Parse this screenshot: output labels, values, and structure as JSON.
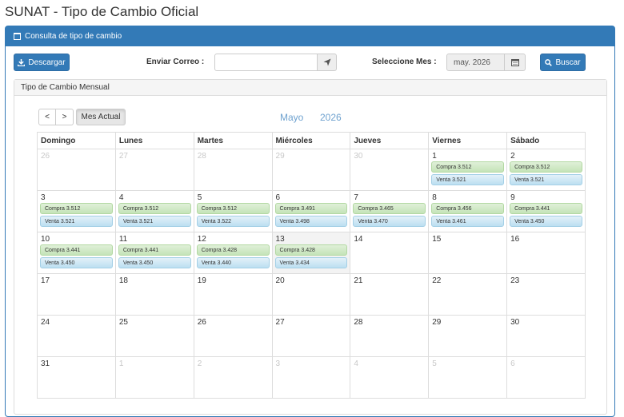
{
  "page": {
    "title": "SUNAT - Tipo de Cambio Oficial"
  },
  "panel": {
    "title": "Consulta de tipo de cambio"
  },
  "toolbar": {
    "download_label": "Descargar",
    "email_label": "Enviar Correo :",
    "email_value": "",
    "month_label": "Seleccione Mes :",
    "month_value": "may. 2026",
    "search_label": "Buscar"
  },
  "calendar": {
    "panel_title": "Tipo de Cambio Mensual",
    "prev_label": "<",
    "next_label": ">",
    "current_month_label": "Mes Actual",
    "month": "Mayo",
    "year": "2026",
    "weekdays": [
      "Domingo",
      "Lunes",
      "Martes",
      "Miércoles",
      "Jueves",
      "Viernes",
      "Sábado"
    ],
    "weeks": [
      [
        {
          "day": "26",
          "other": true
        },
        {
          "day": "27",
          "other": true
        },
        {
          "day": "28",
          "other": true
        },
        {
          "day": "29",
          "other": true
        },
        {
          "day": "30",
          "other": true
        },
        {
          "day": "1",
          "buy": "Compra 3.512",
          "sell": "Venta 3.521"
        },
        {
          "day": "2",
          "buy": "Compra 3.512",
          "sell": "Venta 3.521"
        }
      ],
      [
        {
          "day": "3",
          "buy": "Compra 3.512",
          "sell": "Venta 3.521"
        },
        {
          "day": "4",
          "buy": "Compra 3.512",
          "sell": "Venta 3.521"
        },
        {
          "day": "5",
          "buy": "Compra 3.512",
          "sell": "Venta 3.522"
        },
        {
          "day": "6",
          "buy": "Compra 3.491",
          "sell": "Venta 3.498"
        },
        {
          "day": "7",
          "buy": "Compra 3.465",
          "sell": "Venta 3.470"
        },
        {
          "day": "8",
          "buy": "Compra 3.456",
          "sell": "Venta 3.461"
        },
        {
          "day": "9",
          "buy": "Compra 3.441",
          "sell": "Venta 3.450"
        }
      ],
      [
        {
          "day": "10",
          "buy": "Compra 3.441",
          "sell": "Venta 3.450"
        },
        {
          "day": "11",
          "buy": "Compra 3.441",
          "sell": "Venta 3.450"
        },
        {
          "day": "12",
          "buy": "Compra 3.428",
          "sell": "Venta 3.440"
        },
        {
          "day": "13",
          "today": true,
          "buy": "Compra 3.428",
          "sell": "Venta 3.434"
        },
        {
          "day": "14"
        },
        {
          "day": "15"
        },
        {
          "day": "16"
        }
      ],
      [
        {
          "day": "17"
        },
        {
          "day": "18"
        },
        {
          "day": "19"
        },
        {
          "day": "20"
        },
        {
          "day": "21"
        },
        {
          "day": "22"
        },
        {
          "day": "23"
        }
      ],
      [
        {
          "day": "24"
        },
        {
          "day": "25"
        },
        {
          "day": "26"
        },
        {
          "day": "27"
        },
        {
          "day": "28"
        },
        {
          "day": "29"
        },
        {
          "day": "30"
        }
      ],
      [
        {
          "day": "31"
        },
        {
          "day": "1",
          "other": true
        },
        {
          "day": "2",
          "other": true
        },
        {
          "day": "3",
          "other": true
        },
        {
          "day": "4",
          "other": true
        },
        {
          "day": "5",
          "other": true
        },
        {
          "day": "6",
          "other": true
        }
      ]
    ]
  },
  "colors": {
    "primary": "#337ab7",
    "buy_bg": "#dff0d8",
    "sell_bg": "#d9edf7"
  },
  "icons": {
    "calendar": "calendar-icon",
    "download": "download-icon",
    "send": "send-icon",
    "search": "search-icon"
  }
}
